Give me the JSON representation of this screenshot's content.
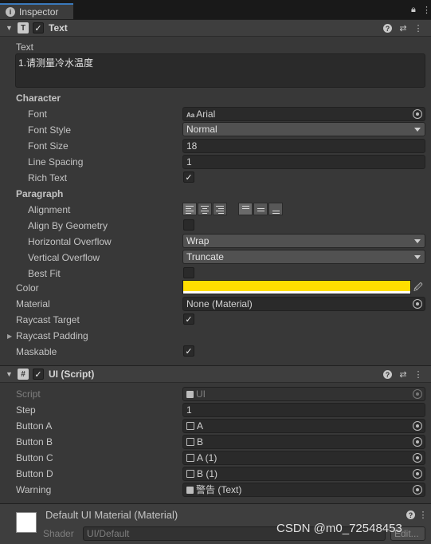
{
  "tab": {
    "title": "Inspector"
  },
  "text_component": {
    "title": "Text",
    "enabled": true,
    "text_label": "Text",
    "text_value": "1.请测量冷水温度",
    "character_header": "Character",
    "font_label": "Font",
    "font_value": "Arial",
    "font_style_label": "Font Style",
    "font_style_value": "Normal",
    "font_size_label": "Font Size",
    "font_size_value": "18",
    "line_spacing_label": "Line Spacing",
    "line_spacing_value": "1",
    "rich_text_label": "Rich Text",
    "rich_text_checked": true,
    "paragraph_header": "Paragraph",
    "alignment_label": "Alignment",
    "align_by_geometry_label": "Align By Geometry",
    "horizontal_overflow_label": "Horizontal Overflow",
    "horizontal_overflow_value": "Wrap",
    "vertical_overflow_label": "Vertical Overflow",
    "vertical_overflow_value": "Truncate",
    "best_fit_label": "Best Fit",
    "color_label": "Color",
    "color_value": "#FFDE00",
    "material_label": "Material",
    "material_value": "None (Material)",
    "raycast_target_label": "Raycast Target",
    "raycast_padding_label": "Raycast Padding",
    "maskable_label": "Maskable"
  },
  "ui_script": {
    "title": "UI (Script)",
    "script_label": "Script",
    "script_value": "UI",
    "step_label": "Step",
    "step_value": "1",
    "button_a_label": "Button A",
    "button_a_value": "A",
    "button_b_label": "Button B",
    "button_b_value": "B",
    "button_c_label": "Button C",
    "button_c_value": "A (1)",
    "button_d_label": "Button D",
    "button_d_value": "B (1)",
    "warning_label": "Warning",
    "warning_value": "警告 (Text)"
  },
  "material": {
    "title": "Default UI Material (Material)",
    "shader_label": "Shader",
    "shader_value": "UI/Default",
    "edit_label": "Edit..."
  },
  "watermark": "CSDN @m0_72548453"
}
